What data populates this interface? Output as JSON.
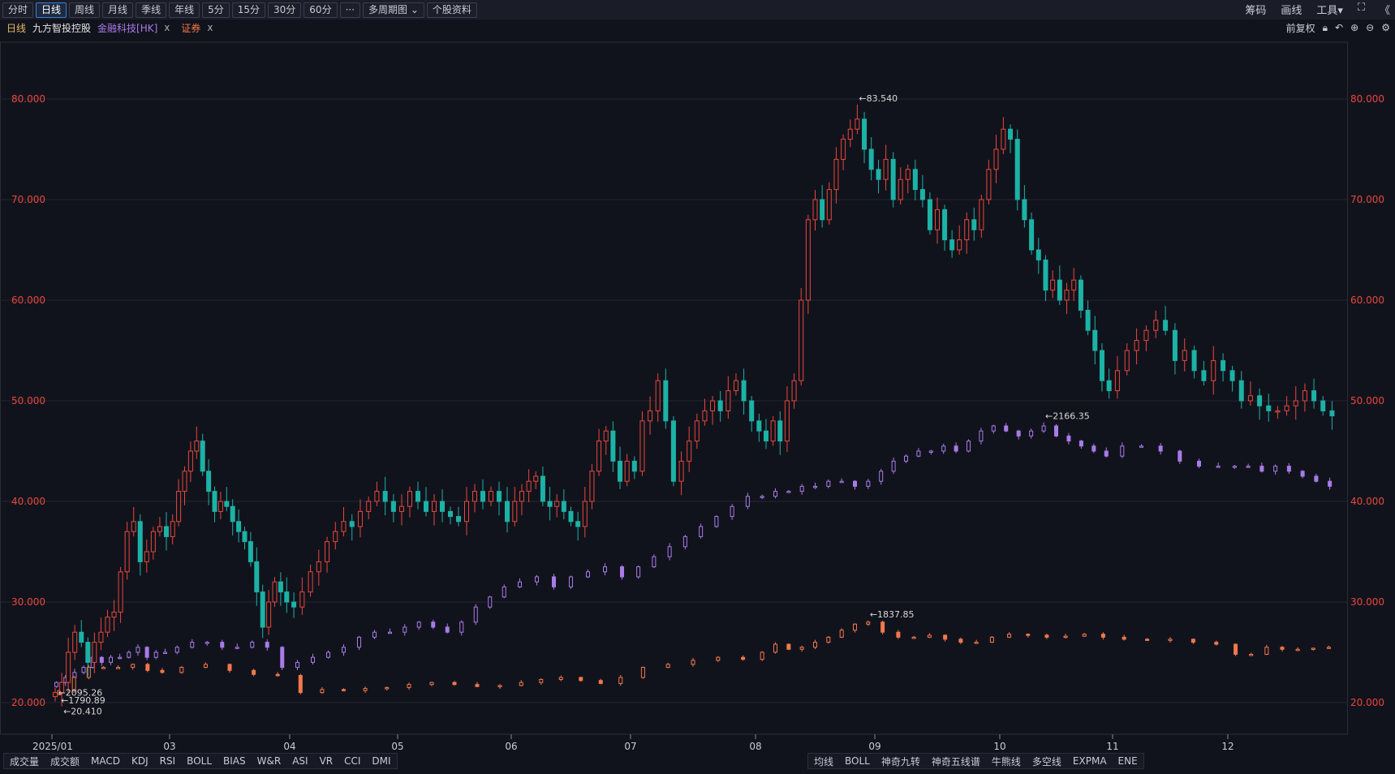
{
  "toolbar": {
    "periods": [
      "分时",
      "日线",
      "周线",
      "月线",
      "季线",
      "年线",
      "5分",
      "15分",
      "30分",
      "60分",
      "···",
      "多周期图 ⌄",
      "个股资料"
    ],
    "active": 1,
    "right": [
      "筹码",
      "画线",
      "工具▾",
      "⛶",
      "《"
    ]
  },
  "legend": {
    "period": "日线",
    "stock": "九方智投控股",
    "index1": "金融科技[HK]",
    "index2": "证券",
    "close": "x"
  },
  "right_controls": {
    "adjust": "前复权",
    "icons": [
      "lock-icon",
      "undo-icon",
      "zoom-in-icon",
      "zoom-out-icon",
      "gear-icon"
    ]
  },
  "colors": {
    "up": "#e8473d",
    "down": "#1db2a6",
    "index1": "#a87be8",
    "index2": "#f2784b",
    "axis": "#e8473d"
  },
  "bottom": {
    "left_tabs": [
      "成交量",
      "成交额",
      "MACD",
      "KDJ",
      "RSI",
      "BOLL",
      "BIAS",
      "W&R",
      "ASI",
      "VR",
      "CCI",
      "DMI"
    ],
    "right_tabs": [
      "均线",
      "BOLL",
      "神奇九转",
      "神奇五线谱",
      "牛熊线",
      "多空线",
      "EXPMA",
      "ENE"
    ]
  },
  "chart_data": {
    "type": "candlestick",
    "ylim": [
      15,
      85
    ],
    "yticks": [
      "80.000",
      "70.000",
      "60.000",
      "50.000",
      "40.000",
      "30.000",
      "20.000"
    ],
    "ytick_values": [
      80,
      70,
      60,
      50,
      40,
      30,
      20
    ],
    "xticks": [
      "2025/01",
      "03",
      "04",
      "05",
      "06",
      "07",
      "08",
      "09",
      "10",
      "11",
      "12"
    ],
    "annotations": {
      "main_high": "←83.540",
      "main_low": "←20.410",
      "idx1_high": "←2166.35",
      "idx1_low": "←2095.26",
      "idx2_high": "←1837.85",
      "idx2_low": "←1790.89"
    },
    "main_close_by_month": [
      [
        21,
        22,
        25,
        27,
        26,
        24,
        26,
        27,
        28.5,
        29,
        33,
        37,
        38,
        34,
        35,
        37,
        37.5,
        36.5
      ],
      [
        38,
        41,
        43,
        45,
        46,
        43,
        41,
        39,
        40,
        39.5,
        38,
        37,
        36,
        34,
        31,
        27.5,
        30,
        32,
        31,
        30
      ],
      [
        29.5,
        31,
        33,
        34,
        36,
        37,
        38,
        37.5,
        39,
        40,
        41,
        40,
        39
      ],
      [
        39.5,
        41,
        40,
        39,
        40,
        39,
        38.5,
        38,
        40,
        41,
        40,
        41,
        40,
        38
      ],
      [
        40,
        41,
        42,
        42.5,
        40,
        39.5,
        40,
        39,
        38,
        37.5,
        40,
        43,
        46,
        47,
        44,
        42,
        44
      ],
      [
        43,
        48,
        49,
        52,
        48,
        42,
        44,
        46,
        48,
        49,
        50,
        49,
        51,
        52,
        50,
        48
      ],
      [
        47,
        46,
        48,
        46,
        50,
        52,
        60,
        68,
        70,
        68,
        71,
        74,
        76,
        77,
        78,
        75,
        73
      ],
      [
        72,
        74,
        70,
        72,
        73,
        71,
        70,
        67,
        69,
        66,
        65,
        66,
        68,
        67,
        70,
        73,
        75
      ],
      [
        77,
        76,
        70,
        68,
        65,
        64,
        61,
        62,
        60,
        61,
        62,
        59,
        57,
        55,
        52,
        51
      ],
      [
        53,
        55,
        56,
        57,
        58,
        57,
        54,
        55,
        53,
        52,
        54,
        53
      ],
      [
        52,
        50,
        50.5,
        49.5,
        49,
        49,
        49.5,
        50,
        51,
        50,
        49,
        48.5
      ]
    ],
    "index1_on_price_scale_by_month": [
      [
        22,
        22.5,
        23,
        23.5,
        24.5,
        24,
        24.5,
        24.5,
        25,
        25.5,
        24.5,
        25,
        25
      ],
      [
        25.5,
        26,
        26,
        25.5,
        25.5,
        26,
        25.5,
        23.5
      ],
      [
        24,
        24.5,
        25,
        25.5,
        26.5,
        27,
        27
      ],
      [
        27.5,
        28,
        27.5,
        27,
        28,
        29.5,
        30.5,
        31.5
      ],
      [
        32,
        32.5,
        31.5,
        32.5,
        33,
        33.5,
        32.5
      ],
      [
        33.5,
        34.5,
        35.5,
        36.5,
        37.5,
        38.5,
        39.5,
        40.5
      ],
      [
        40.5,
        41,
        41,
        41.5,
        41.5,
        42,
        42,
        41.5,
        42
      ],
      [
        43,
        44,
        44.5,
        45,
        45,
        45.5,
        45,
        46,
        47,
        47.5
      ],
      [
        47,
        46.5,
        47,
        47.5,
        46.5,
        46,
        45.5,
        45,
        44.5
      ],
      [
        45.5,
        45.5,
        45,
        44,
        43.5,
        43.5
      ],
      [
        43.5,
        43.5,
        43,
        43.5,
        43,
        42.5,
        42,
        41.5
      ]
    ],
    "index2_on_price_scale_by_month": [
      [
        21.2,
        22.5,
        23.5,
        23.5,
        23.5,
        23.8,
        23.2,
        23
      ],
      [
        23.5,
        23.8,
        23.2,
        22.8,
        22.7
      ],
      [
        21,
        21.3,
        21.2,
        21.4,
        21.5
      ],
      [
        21.8,
        22,
        21.8,
        21.6,
        21.7
      ],
      [
        22,
        22.3,
        22.5,
        22.2,
        21.9,
        22.5
      ],
      [
        23.5,
        23.8,
        24.2,
        24.5,
        24.3
      ],
      [
        25,
        25.8,
        25.3,
        25.5,
        26,
        26.5,
        27.2,
        27.8,
        28
      ],
      [
        27,
        26.5,
        26.5,
        26.7,
        26.3,
        26,
        26,
        26.5
      ],
      [
        26.8,
        26.7,
        26.5,
        26.6,
        26.8,
        26.5
      ],
      [
        26.3,
        26.2,
        26.3,
        26,
        25.8
      ],
      [
        24.8,
        24.8,
        25.5,
        25.3,
        25.3,
        25.4,
        25.5
      ]
    ]
  }
}
